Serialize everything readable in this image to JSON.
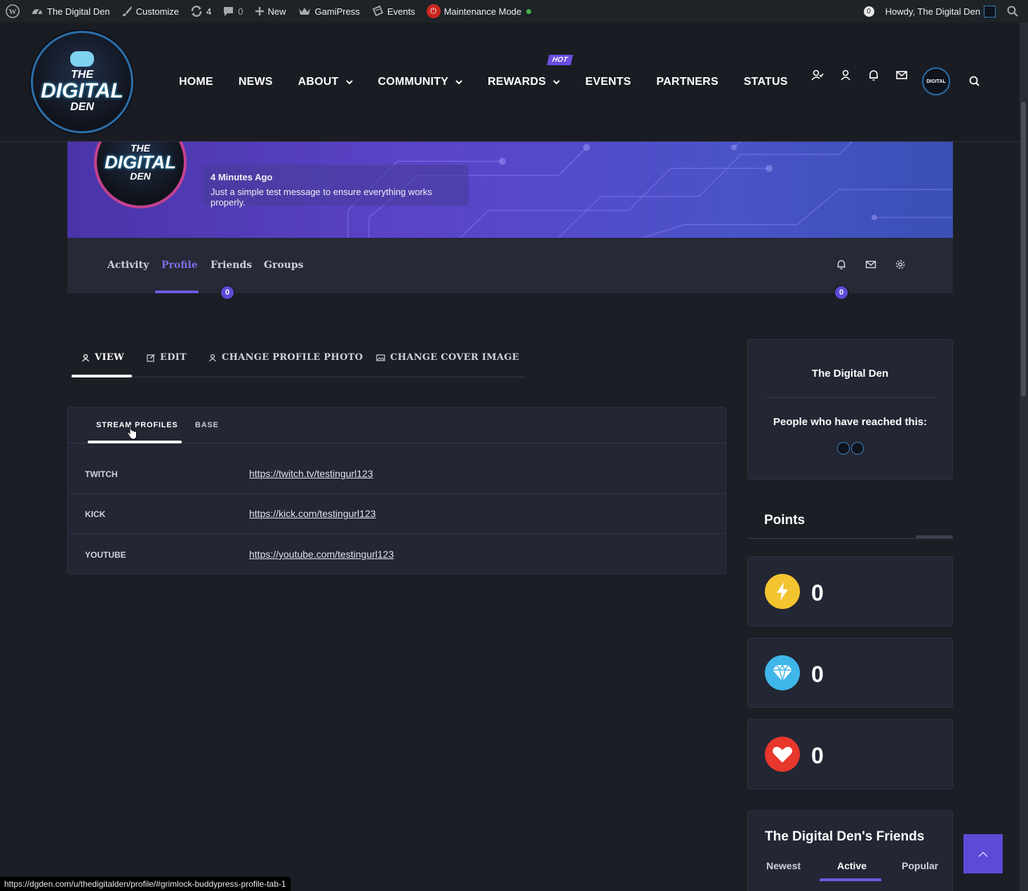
{
  "adminbar": {
    "site_name": "The Digital Den",
    "customize": "Customize",
    "updates_count": "4",
    "comments_count": "0",
    "new_label": "New",
    "gamipress": "GamiPress",
    "events": "Events",
    "maintenance": "Maintenance Mode",
    "notif_count": "0",
    "howdy": "Howdy, The Digital Den"
  },
  "logo": {
    "line1": "THE",
    "line2": "DIGITAL",
    "line3": "DEN"
  },
  "nav": {
    "home": "HOME",
    "news": "NEWS",
    "about": "ABOUT",
    "community": "COMMUNITY",
    "rewards": "REWARDS",
    "hot_badge": "HOT",
    "events": "EVENTS",
    "partners": "PARTNERS",
    "status": "STATUS"
  },
  "profile": {
    "status_time": "4 Minutes Ago",
    "status_message": "Just a simple test message to ensure everything works properly."
  },
  "profile_tabs": {
    "activity": "Activity",
    "profile": "Profile",
    "friends": "Friends",
    "groups": "Groups",
    "friends_count": "0",
    "notifications_count": "0"
  },
  "subtabs": {
    "view": "VIEW",
    "edit": "EDIT",
    "change_photo": "CHANGE PROFILE PHOTO",
    "change_cover": "CHANGE COVER IMAGE"
  },
  "field_tabs": {
    "stream_profiles": "STREAM PROFILES",
    "base": "BASE"
  },
  "fields": [
    {
      "label": "TWITCH",
      "value": "https://twitch.tv/testingurl123"
    },
    {
      "label": "KICK",
      "value": "https://kick.com/testingurl123"
    },
    {
      "label": "YOUTUBE",
      "value": "https://youtube.com/testingurl123"
    }
  ],
  "sidebar": {
    "achievement_title": "The Digital Den",
    "reached_label": "People who have reached this:",
    "points_title": "Points",
    "points": [
      {
        "icon": "lightning-icon",
        "value": "0",
        "color": "#f4c430"
      },
      {
        "icon": "diamond-icon",
        "value": "0",
        "color": "#3fb6ea"
      },
      {
        "icon": "heart-icon",
        "value": "0",
        "color": "#e8372d"
      }
    ],
    "friends_title": "The Digital Den's Friends",
    "friends_tabs": {
      "newest": "Newest",
      "active": "Active",
      "popular": "Popular"
    }
  },
  "status_url": "https://dgden.com/u/thedigitalden/profile/#grimlock-buddypress-profile-tab-1",
  "colors": {
    "accent": "#5b4bd6",
    "bg": "#1c1e26",
    "card": "#232633"
  }
}
